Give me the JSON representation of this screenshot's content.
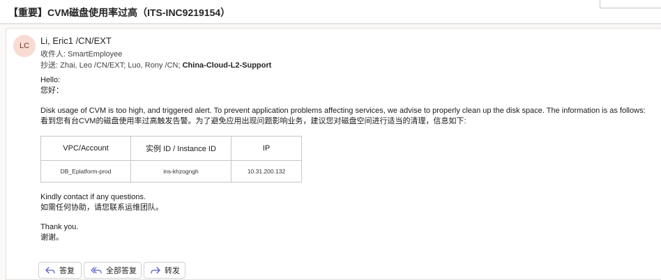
{
  "email": {
    "subject": "【重要】CVM磁盘使用率过高（ITS-INC9219154）",
    "sender": {
      "initials": "LC",
      "name": "Li, Eric1 /CN/EXT"
    },
    "to": {
      "label": "收件人:",
      "value": "SmartEmployee"
    },
    "cc": {
      "label": "抄送:",
      "plain": "Zhai, Leo /CN/EXT;  Luo, Rony /CN;",
      "bold": "China-Cloud-L2-Support"
    },
    "body": {
      "greeting_en": "Hello:",
      "greeting_zh": "您好：",
      "para_en": "Disk usage of CVM is too high, and triggered alert. To prevent application problems affecting services, we advise to properly clean up the disk space. The information is as follows:",
      "para_zh": "看到您有台CVM的磁盘使用率过高触发告警。为了避免应用出现问题影响业务，建议您对磁盘空间进行适当的清理，信息如下:",
      "table": {
        "headers": [
          "VPC/Account",
          "实例 ID / Instance ID",
          "IP"
        ],
        "rows": [
          [
            "DB_Eplatform-prod",
            "ins-khzogngh",
            "10.31.200.132"
          ]
        ]
      },
      "contact_en": "Kindly contact if any questions.",
      "contact_zh": "如需任何协助，请您联系运维团队。",
      "thanks_en": "Thank you.",
      "thanks_zh": "谢谢。"
    }
  },
  "actions": {
    "reply": "答复",
    "reply_all": "全部答复",
    "forward": "转发"
  },
  "colors": {
    "avatar_bg": "#f8dbd2",
    "icon_blue": "#5b5fc7"
  }
}
